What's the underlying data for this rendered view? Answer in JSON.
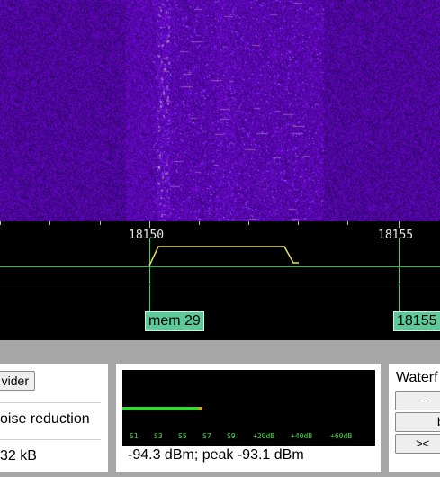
{
  "scale": {
    "marker_left": "18150",
    "marker_right": "18155",
    "mem_tag_left": "mem 29",
    "mem_tag_right": "18155"
  },
  "controls": {
    "wider_label": "vider",
    "noise_reduction_label": "oise reduction",
    "kb_label": "32 kB",
    "smeter": {
      "ticks": [
        "S1",
        "S3",
        "S5",
        "S7",
        "S9",
        "+20dB",
        "+40dB",
        "+60dB"
      ],
      "level_fraction": 0.31,
      "readout": "-94.3 dBm; peak  -93.1 dBm"
    },
    "waterfall": {
      "title": "Waterf",
      "minus_label": "–",
      "b_label": "b",
      "arrows_label": "><"
    }
  },
  "colors": {
    "waterfall_bg": "#2a0a6a",
    "passband": "#e6e05a",
    "carrier_line": "#2dbb4a",
    "mem_tag": "#5dc99a",
    "smeter_bar": "#3ad63a",
    "smeter_peak": "#e89a2a"
  }
}
